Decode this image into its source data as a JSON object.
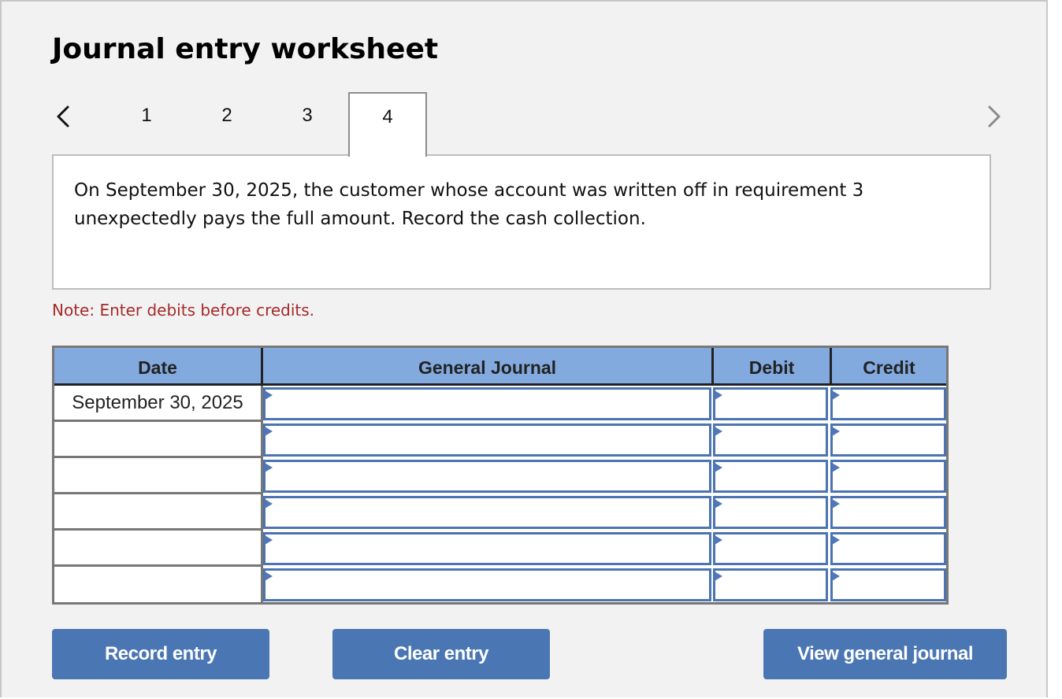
{
  "title": "Journal entry worksheet",
  "navigation": {
    "prev_icon": "chevron-left-icon",
    "next_icon": "chevron-right-icon",
    "tabs": [
      {
        "label": "1",
        "active": false
      },
      {
        "label": "2",
        "active": false
      },
      {
        "label": "3",
        "active": false
      },
      {
        "label": "4",
        "active": true
      }
    ]
  },
  "prompt": "On September 30, 2025, the customer whose account was written off in requirement 3 unexpectedly pays the full amount. Record the cash collection.",
  "note": "Note: Enter debits before credits.",
  "table": {
    "columns": [
      "Date",
      "General Journal",
      "Debit",
      "Credit"
    ],
    "rows": [
      {
        "date": "September 30, 2025",
        "account": "",
        "debit": "",
        "credit": ""
      },
      {
        "date": "",
        "account": "",
        "debit": "",
        "credit": ""
      },
      {
        "date": "",
        "account": "",
        "debit": "",
        "credit": ""
      },
      {
        "date": "",
        "account": "",
        "debit": "",
        "credit": ""
      },
      {
        "date": "",
        "account": "",
        "debit": "",
        "credit": ""
      },
      {
        "date": "",
        "account": "",
        "debit": "",
        "credit": ""
      }
    ]
  },
  "buttons": {
    "record": "Record entry",
    "clear": "Clear entry",
    "view": "View general journal"
  },
  "colors": {
    "header_bg": "#82aadf",
    "button_bg": "#4a76b4",
    "note_text": "#a52a2a",
    "input_border": "#4c74b0"
  }
}
